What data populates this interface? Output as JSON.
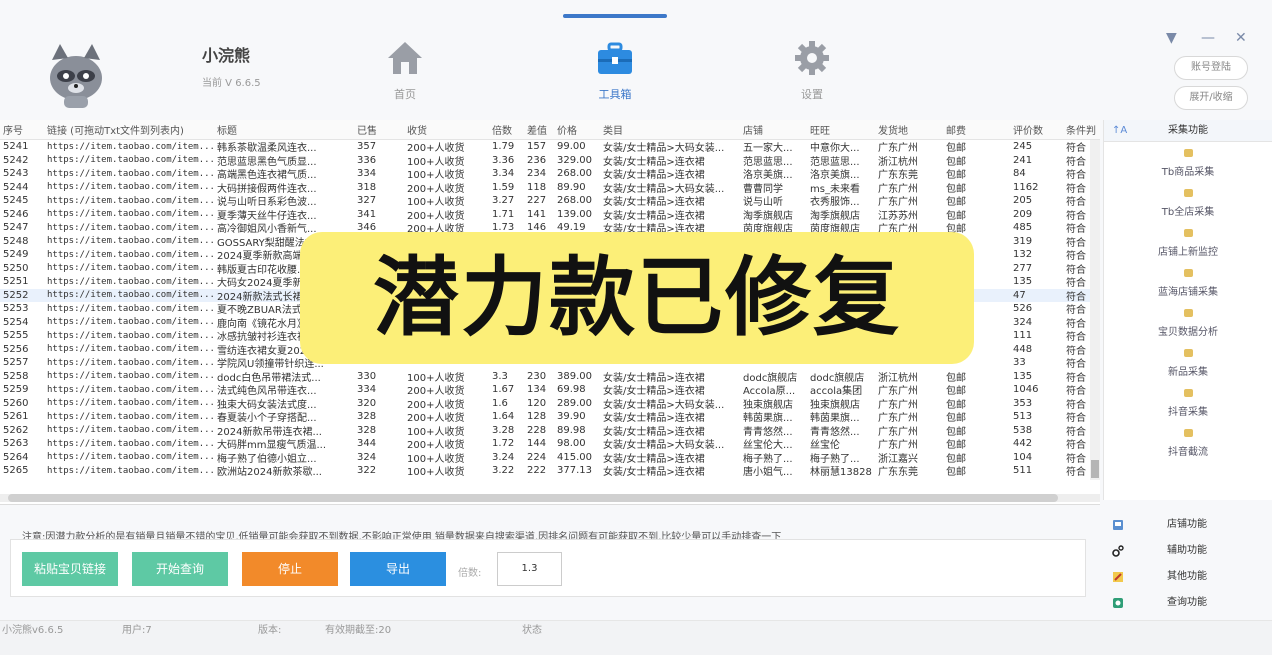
{
  "app": {
    "name": "小浣熊",
    "version": "当前 V 6.6.5"
  },
  "nav": {
    "home": "首页",
    "tools": "工具箱",
    "settings": "设置"
  },
  "account": {
    "login": "账号登陆",
    "expand": "展开/收缩"
  },
  "table": {
    "headers": [
      "序号",
      "链接 (可拖动Txt文件到列表内)",
      "标题",
      "已售",
      "收货",
      "倍数",
      "差值",
      "价格",
      "类目",
      "店铺",
      "旺旺",
      "发货地",
      "邮费",
      "评价数",
      "条件判"
    ],
    "rows": [
      [
        "5241",
        "https://item.taobao.com/item...",
        "韩系茶歇温柔风连衣...",
        "357",
        "200+人收货",
        "1.79",
        "157",
        "99.00",
        "女装/女士精品>大码女装...",
        "五一家大...",
        "中意你大...",
        "广东广州",
        "包邮",
        "245",
        "符合"
      ],
      [
        "5242",
        "https://item.taobao.com/item...",
        "范思蓝思黑色气质显...",
        "336",
        "100+人收货",
        "3.36",
        "236",
        "329.00",
        "女装/女士精品>连衣裙",
        "范思蓝思...",
        "范思蓝思...",
        "浙江杭州",
        "包邮",
        "241",
        "符合"
      ],
      [
        "5243",
        "https://item.taobao.com/item...",
        "高端黑色连衣裙气质...",
        "334",
        "100+人收货",
        "3.34",
        "234",
        "268.00",
        "女装/女士精品>连衣裙",
        "洛京美旗...",
        "洛京美旗...",
        "广东东莞",
        "包邮",
        "84",
        "符合"
      ],
      [
        "5244",
        "https://item.taobao.com/item...",
        "大码拼接假两件连衣...",
        "318",
        "200+人收货",
        "1.59",
        "118",
        "89.90",
        "女装/女士精品>大码女装...",
        "曹曹同学",
        "ms_未来看",
        "广东广州",
        "包邮",
        "1162",
        "符合"
      ],
      [
        "5245",
        "https://item.taobao.com/item...",
        "说与山听日系彩色波...",
        "327",
        "100+人收货",
        "3.27",
        "227",
        "268.00",
        "女装/女士精品>连衣裙",
        "说与山听",
        "衣秀服饰...",
        "广东广州",
        "包邮",
        "205",
        "符合"
      ],
      [
        "5246",
        "https://item.taobao.com/item...",
        "夏季薄天丝牛仔连衣...",
        "341",
        "200+人收货",
        "1.71",
        "141",
        "139.00",
        "女装/女士精品>连衣裙",
        "淘季旗舰店",
        "淘季旗舰店",
        "江苏苏州",
        "包邮",
        "209",
        "符合"
      ],
      [
        "5247",
        "https://item.taobao.com/item...",
        "高冷御姐风小香新气...",
        "346",
        "200+人收货",
        "1.73",
        "146",
        "49.19",
        "女装/女士精品>连衣裙",
        "茵度旗舰店",
        "茵度旗舰店",
        "广东广州",
        "包邮",
        "485",
        "符合"
      ],
      [
        "5248",
        "https://item.taobao.com/item...",
        "GOSSARY梨甜醒法式...",
        "",
        "",
        "",
        "",
        "",
        "",
        "",
        "",
        "",
        "",
        "319",
        "符合"
      ],
      [
        "5249",
        "https://item.taobao.com/item...",
        "2024夏季新款高端气...",
        "",
        "",
        "",
        "",
        "",
        "",
        "",
        "",
        "",
        "",
        "132",
        "符合"
      ],
      [
        "5250",
        "https://item.taobao.com/item...",
        "韩版夏古印花收腰...",
        "",
        "",
        "",
        "",
        "",
        "",
        "",
        "",
        "",
        "",
        "277",
        "符合"
      ],
      [
        "5251",
        "https://item.taobao.com/item...",
        "大码女2024夏季新款...",
        "",
        "",
        "",
        "",
        "",
        "",
        "",
        "",
        "",
        "",
        "135",
        "符合"
      ],
      [
        "5252",
        "https://item.taobao.com/item...",
        "2024新款法式长裙...",
        "",
        "",
        "",
        "",
        "",
        "",
        "",
        "",
        "",
        "",
        "47",
        "符合"
      ],
      [
        "5253",
        "https://item.taobao.com/item...",
        "夏不晚ZBUAR法式收...",
        "",
        "",
        "",
        "",
        "",
        "",
        "",
        "",
        "",
        "",
        "526",
        "符合"
      ],
      [
        "5254",
        "https://item.taobao.com/item...",
        "鹿向南《镜花水月》...",
        "",
        "",
        "",
        "",
        "",
        "",
        "",
        "",
        "",
        "",
        "324",
        "符合"
      ],
      [
        "5255",
        "https://item.taobao.com/item...",
        "冰感抗皱衬衫连衣裙...",
        "",
        "",
        "",
        "",
        "",
        "",
        "",
        "",
        "",
        "",
        "111",
        "符合"
      ],
      [
        "5256",
        "https://item.taobao.com/item...",
        "雪纺连衣裙女夏2024...",
        "",
        "",
        "",
        "",
        "",
        "",
        "",
        "",
        "",
        "",
        "448",
        "符合"
      ],
      [
        "5257",
        "https://item.taobao.com/item...",
        "学院风U领撞带针织连...",
        "",
        "",
        "",
        "",
        "",
        "",
        "",
        "",
        "",
        "",
        "33",
        "符合"
      ],
      [
        "5258",
        "https://item.taobao.com/item...",
        "dodc白色吊带裙法式...",
        "330",
        "100+人收货",
        "3.3",
        "230",
        "389.00",
        "女装/女士精品>连衣裙",
        "dodc旗舰店",
        "dodc旗舰店",
        "浙江杭州",
        "包邮",
        "135",
        "符合"
      ],
      [
        "5259",
        "https://item.taobao.com/item...",
        "法式纯色风吊带连衣...",
        "334",
        "200+人收货",
        "1.67",
        "134",
        "69.98",
        "女装/女士精品>连衣裙",
        "Accola原...",
        "accola集团",
        "广东广州",
        "包邮",
        "1046",
        "符合"
      ],
      [
        "5260",
        "https://item.taobao.com/item...",
        "独束大码女装法式度...",
        "320",
        "200+人收货",
        "1.6",
        "120",
        "289.00",
        "女装/女士精品>大码女装...",
        "独束旗舰店",
        "独束旗舰店",
        "广东广州",
        "包邮",
        "353",
        "符合"
      ],
      [
        "5261",
        "https://item.taobao.com/item...",
        "春夏装小个子穿搭配...",
        "328",
        "200+人收货",
        "1.64",
        "128",
        "39.90",
        "女装/女士精品>连衣裙",
        "韩茵果旗...",
        "韩茵果旗...",
        "广东广州",
        "包邮",
        "513",
        "符合"
      ],
      [
        "5262",
        "https://item.taobao.com/item...",
        "2024新款吊带连衣裙...",
        "328",
        "100+人收货",
        "3.28",
        "228",
        "89.98",
        "女装/女士精品>连衣裙",
        "青青悠然...",
        "青青悠然...",
        "广东广州",
        "包邮",
        "538",
        "符合"
      ],
      [
        "5263",
        "https://item.taobao.com/item...",
        "大码胖mm显瘦气质温...",
        "344",
        "200+人收货",
        "1.72",
        "144",
        "98.00",
        "女装/女士精品>大码女装...",
        "丝宝伦大...",
        "丝宝伦",
        "广东广州",
        "包邮",
        "442",
        "符合"
      ],
      [
        "5264",
        "https://item.taobao.com/item...",
        "梅子熟了伯德小姐立...",
        "324",
        "100+人收货",
        "3.24",
        "224",
        "415.00",
        "女装/女士精品>连衣裙",
        "梅子熟了...",
        "梅子熟了...",
        "浙江嘉兴",
        "包邮",
        "104",
        "符合"
      ],
      [
        "5265",
        "https://item.taobao.com/item...",
        "欧洲站2024新款茶歇...",
        "322",
        "100+人收货",
        "3.22",
        "222",
        "377.13",
        "女装/女士精品>连衣裙",
        "唐小姐气...",
        "林丽慧13828",
        "广东东莞",
        "包邮",
        "511",
        "符合"
      ]
    ]
  },
  "banner": "潜力款已修复",
  "sidebar": {
    "title": "采集功能",
    "items": [
      "Tb商品采集",
      "Tb全店采集",
      "店铺上新监控",
      "蓝海店铺采集",
      "宝贝数据分析",
      "新品采集",
      "抖音采集",
      "抖音截流"
    ]
  },
  "notice": "注意:因潜力款分析的是有销量且销量不错的宝贝,低销量可能会获取不到数据,不影响正常使用  销量数据来自搜索渠道,因排名问题有可能获取不到,比较少量可以手动排查一下",
  "actions": {
    "paste": "粘贴宝贝链接",
    "start": "开始查询",
    "stop": "停止",
    "export": "导出",
    "ratio_label": "倍数:",
    "ratio_value": "1.3"
  },
  "functions": [
    "店铺功能",
    "辅助功能",
    "其他功能",
    "查询功能"
  ],
  "status": {
    "version": "小浣熊v6.6.5",
    "user": "用户:7",
    "version_label": "版本:",
    "expiry": "有效期截至:20",
    "state": "状态"
  }
}
